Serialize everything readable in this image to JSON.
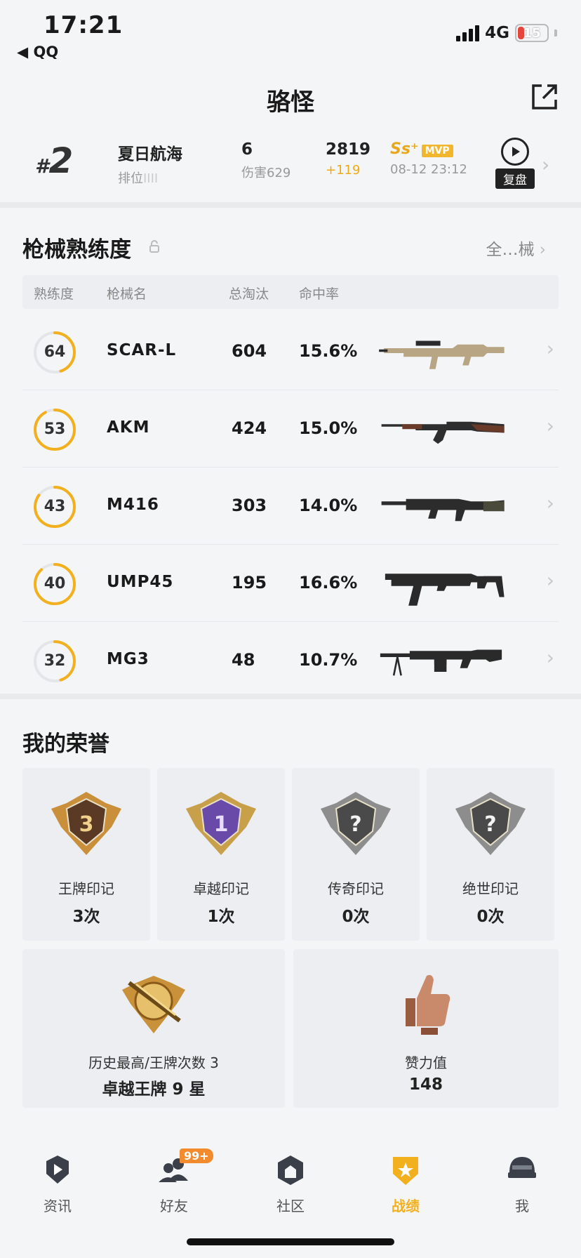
{
  "status_bar": {
    "time": "17:21",
    "back_app": "◀ QQ",
    "network": "4G",
    "battery": "15"
  },
  "header": {
    "title": "骆怪"
  },
  "match": {
    "rank_prefix": "#",
    "rank": "2",
    "mode": "夏日航海",
    "mode_sub": "排位",
    "kills": "6",
    "damage": "伤害629",
    "score": "2819",
    "score_delta": "+119",
    "tier": "Ss⁺",
    "mvp": "MVP",
    "time": "08-12 23:12",
    "replay_label": "复盘"
  },
  "weapons": {
    "title": "枪械熟练度",
    "see_all": "全…械",
    "headers": {
      "proficiency": "熟练度",
      "name": "枪械名",
      "kills": "总淘汰",
      "hit_rate": "命中率"
    },
    "rows": [
      {
        "proficiency": "64",
        "progress": 0.45,
        "name": "SCAR-L",
        "kills": "604",
        "hit_rate": "15.6%",
        "gun": "scar-l-rifle"
      },
      {
        "proficiency": "53",
        "progress": 0.92,
        "name": "AKM",
        "kills": "424",
        "hit_rate": "15.0%",
        "gun": "akm-rifle"
      },
      {
        "proficiency": "43",
        "progress": 0.85,
        "name": "M416",
        "kills": "303",
        "hit_rate": "14.0%",
        "gun": "m416-rifle"
      },
      {
        "proficiency": "40",
        "progress": 0.88,
        "name": "UMP45",
        "kills": "195",
        "hit_rate": "16.6%",
        "gun": "ump45-smg"
      },
      {
        "proficiency": "32",
        "progress": 0.45,
        "name": "MG3",
        "kills": "48",
        "hit_rate": "10.7%",
        "gun": "mg3-machinegun"
      }
    ]
  },
  "honors": {
    "title": "我的荣誉",
    "marks": [
      {
        "label": "王牌印记",
        "count": "3次",
        "emblem": "ace-mark-3",
        "numeral": "3"
      },
      {
        "label": "卓越印记",
        "count": "1次",
        "emblem": "excellence-mark-1",
        "numeral": "1"
      },
      {
        "label": "传奇印记",
        "count": "0次",
        "emblem": "legend-mark-locked",
        "numeral": "?"
      },
      {
        "label": "绝世印记",
        "count": "0次",
        "emblem": "peerless-mark-locked",
        "numeral": "?"
      }
    ],
    "best": {
      "label": "历史最高/王牌次数 3",
      "value": "卓越王牌 9 星"
    },
    "likes": {
      "label": "赞力值",
      "value": "148"
    }
  },
  "nav": {
    "items": [
      {
        "label": "资讯",
        "icon": "news-icon"
      },
      {
        "label": "好友",
        "icon": "friends-icon",
        "badge": "99+"
      },
      {
        "label": "社区",
        "icon": "community-icon"
      },
      {
        "label": "战绩",
        "icon": "record-icon",
        "active": true
      },
      {
        "label": "我",
        "icon": "profile-helmet-icon"
      }
    ]
  },
  "colors": {
    "accent": "#f2b01e",
    "ring": "#f2b01e",
    "background": "#f4f5f7"
  }
}
